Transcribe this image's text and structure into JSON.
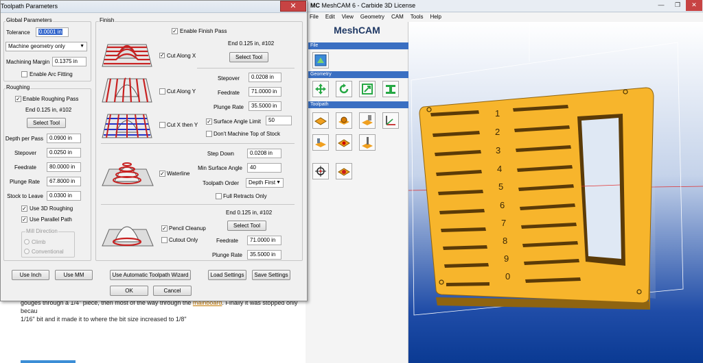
{
  "background_page": {
    "text_before_link": "gouges through a 1/4\" piece, then most of the way through the",
    "link_text": "mainboard",
    "text_after_link": ". Finally it was stopped only becau",
    "line2": "1/16\" bit and it made it to where the bit size increased to 1/8\""
  },
  "meshcam": {
    "title": "MeshCAM 6 - Carbide 3D License",
    "title_prefix": "MC",
    "window_buttons": [
      "—",
      "❐",
      "✕"
    ],
    "menu": [
      "File",
      "Edit",
      "View",
      "Geometry",
      "CAM",
      "Tools",
      "Help"
    ],
    "brand": "MeshCAM",
    "sections": [
      "File",
      "Geometry",
      "Toolpath"
    ],
    "part_numbers": [
      "1",
      "2",
      "3",
      "4",
      "5",
      "6",
      "7",
      "8",
      "9",
      "0"
    ],
    "colors": {
      "part": "#f7b52c",
      "part_dark": "#b07a0f",
      "section": "#3a6fc2",
      "view_bottom": "#0a3a93"
    }
  },
  "dialog": {
    "title": "Toolpath Parameters",
    "close": "✕",
    "global": {
      "label": "Global Parameters",
      "tolerance_label": "Tolerance",
      "tolerance_value": "0.0001 in",
      "geometry_select": "Machine geometry only",
      "margin_label": "Machining Margin",
      "margin_value": "0.1375 in",
      "arc_fitting": "Enable Arc Fitting"
    },
    "roughing": {
      "label": "Roughing",
      "enable": "Enable Roughing Pass",
      "tool_info": "End 0.125 in, #102",
      "select_tool": "Select Tool",
      "depth_label": "Depth per Pass",
      "depth_value": "0.0900 in",
      "stepover_label": "Stepover",
      "stepover_value": "0.0250 in",
      "feedrate_label": "Feedrate",
      "feedrate_value": "80.0000 in",
      "plunge_label": "Plunge Rate",
      "plunge_value": "67.8000 in",
      "stock_label": "Stock to Leave",
      "stock_value": "0.0300 in",
      "use_3d": "Use 3D Roughing",
      "use_parallel": "Use Parallel Path",
      "mill_direction": "Mill Direction",
      "climb": "Climb",
      "conventional": "Conventional"
    },
    "finish": {
      "label": "Finish",
      "enable": "Enable Finish Pass",
      "tool_info": "End 0.125 in, #102",
      "select_tool": "Select Tool",
      "cut_along_x": "Cut Along X",
      "cut_along_y": "Cut Along Y",
      "cut_x_then_y": "Cut X then Y",
      "stepover_label": "Stepover",
      "stepover_value": "0.0208 in",
      "feedrate_label": "Feedrate",
      "feedrate_value": "71.0000 in",
      "plunge_label": "Plunge Rate",
      "plunge_value": "35.5000 in",
      "surface_angle": "Surface Angle Limit",
      "surface_angle_value": "50",
      "dont_machine_top": "Don't Machine Top of Stock",
      "waterline": "Waterline",
      "step_down_label": "Step Down",
      "step_down_value": "0.0208 in",
      "min_surface_label": "Min Surface Angle",
      "min_surface_value": "40",
      "order_label": "Toolpath Order",
      "order_value": "Depth First",
      "full_retracts": "Full Retracts Only",
      "pencil_tool_info": "End 0.125 in, #102",
      "pencil_select_tool": "Select Tool",
      "pencil_cleanup": "Pencil Cleanup",
      "cutout_only": "Cutout Only",
      "pencil_feedrate_label": "Feedrate",
      "pencil_feedrate_value": "71.0000 in",
      "pencil_plunge_label": "Plunge Rate",
      "pencil_plunge_value": "35.5000 in"
    },
    "buttons": {
      "use_inch": "Use Inch",
      "use_mm": "Use MM",
      "wizard": "Use Automatic Toolpath Wizard",
      "load": "Load Settings",
      "save": "Save Settings",
      "ok": "OK",
      "cancel": "Cancel"
    },
    "check": "✓"
  }
}
